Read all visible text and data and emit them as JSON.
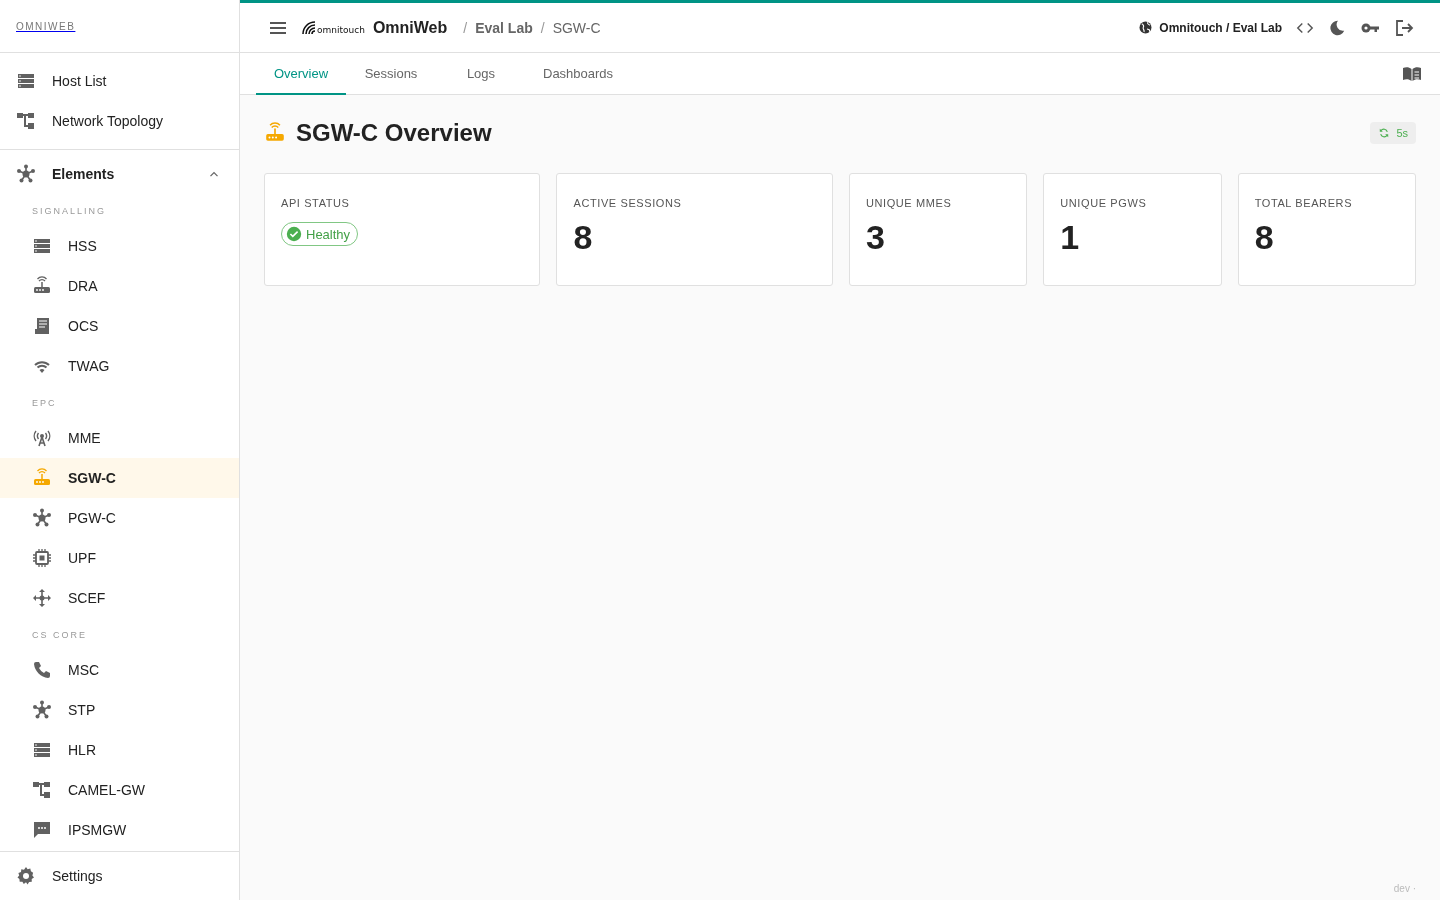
{
  "sidebar": {
    "brand": "OMNIWEB",
    "top_items": [
      {
        "label": "Host List",
        "selected": false
      },
      {
        "label": "Network Topology",
        "selected": false
      }
    ],
    "group": {
      "label": "Elements",
      "expanded": true,
      "sections": [
        {
          "heading": "SIGNALLING",
          "items": [
            {
              "label": "HSS",
              "selected": false
            },
            {
              "label": "DRA",
              "selected": false
            },
            {
              "label": "OCS",
              "selected": false
            },
            {
              "label": "TWAG",
              "selected": false
            }
          ]
        },
        {
          "heading": "EPC",
          "items": [
            {
              "label": "MME",
              "selected": false
            },
            {
              "label": "SGW-C",
              "selected": true
            },
            {
              "label": "PGW-C",
              "selected": false
            },
            {
              "label": "UPF",
              "selected": false
            },
            {
              "label": "SCEF",
              "selected": false
            }
          ]
        },
        {
          "heading": "CS CORE",
          "items": [
            {
              "label": "MSC",
              "selected": false
            },
            {
              "label": "STP",
              "selected": false
            },
            {
              "label": "HLR",
              "selected": false
            },
            {
              "label": "CAMEL-GW",
              "selected": false
            },
            {
              "label": "IPSMGW",
              "selected": false
            }
          ]
        }
      ]
    },
    "footer": {
      "label": "Settings"
    }
  },
  "header": {
    "logo_text": "omnitouch",
    "app_name": "OmniWeb",
    "breadcrumb_separator": "/",
    "breadcrumbs": [
      "Eval Lab",
      "SGW-C"
    ],
    "tenant": "Omnitouch / Eval Lab"
  },
  "tabs": [
    {
      "label": "Overview",
      "selected": true
    },
    {
      "label": "Sessions",
      "selected": false
    },
    {
      "label": "Logs",
      "selected": false
    },
    {
      "label": "Dashboards",
      "selected": false
    }
  ],
  "page": {
    "title": "SGW-C Overview",
    "refresh": "5s"
  },
  "cards": [
    {
      "kind": "status",
      "label": "API STATUS",
      "value": "Healthy"
    },
    {
      "kind": "count",
      "label": "ACTIVE SESSIONS",
      "value": "8"
    },
    {
      "kind": "count",
      "label": "UNIQUE MMES",
      "value": "3"
    },
    {
      "kind": "count",
      "label": "UNIQUE PGWS",
      "value": "1"
    },
    {
      "kind": "count",
      "label": "TOTAL BEARERS",
      "value": "8"
    }
  ],
  "footer_note": "dev ·"
}
